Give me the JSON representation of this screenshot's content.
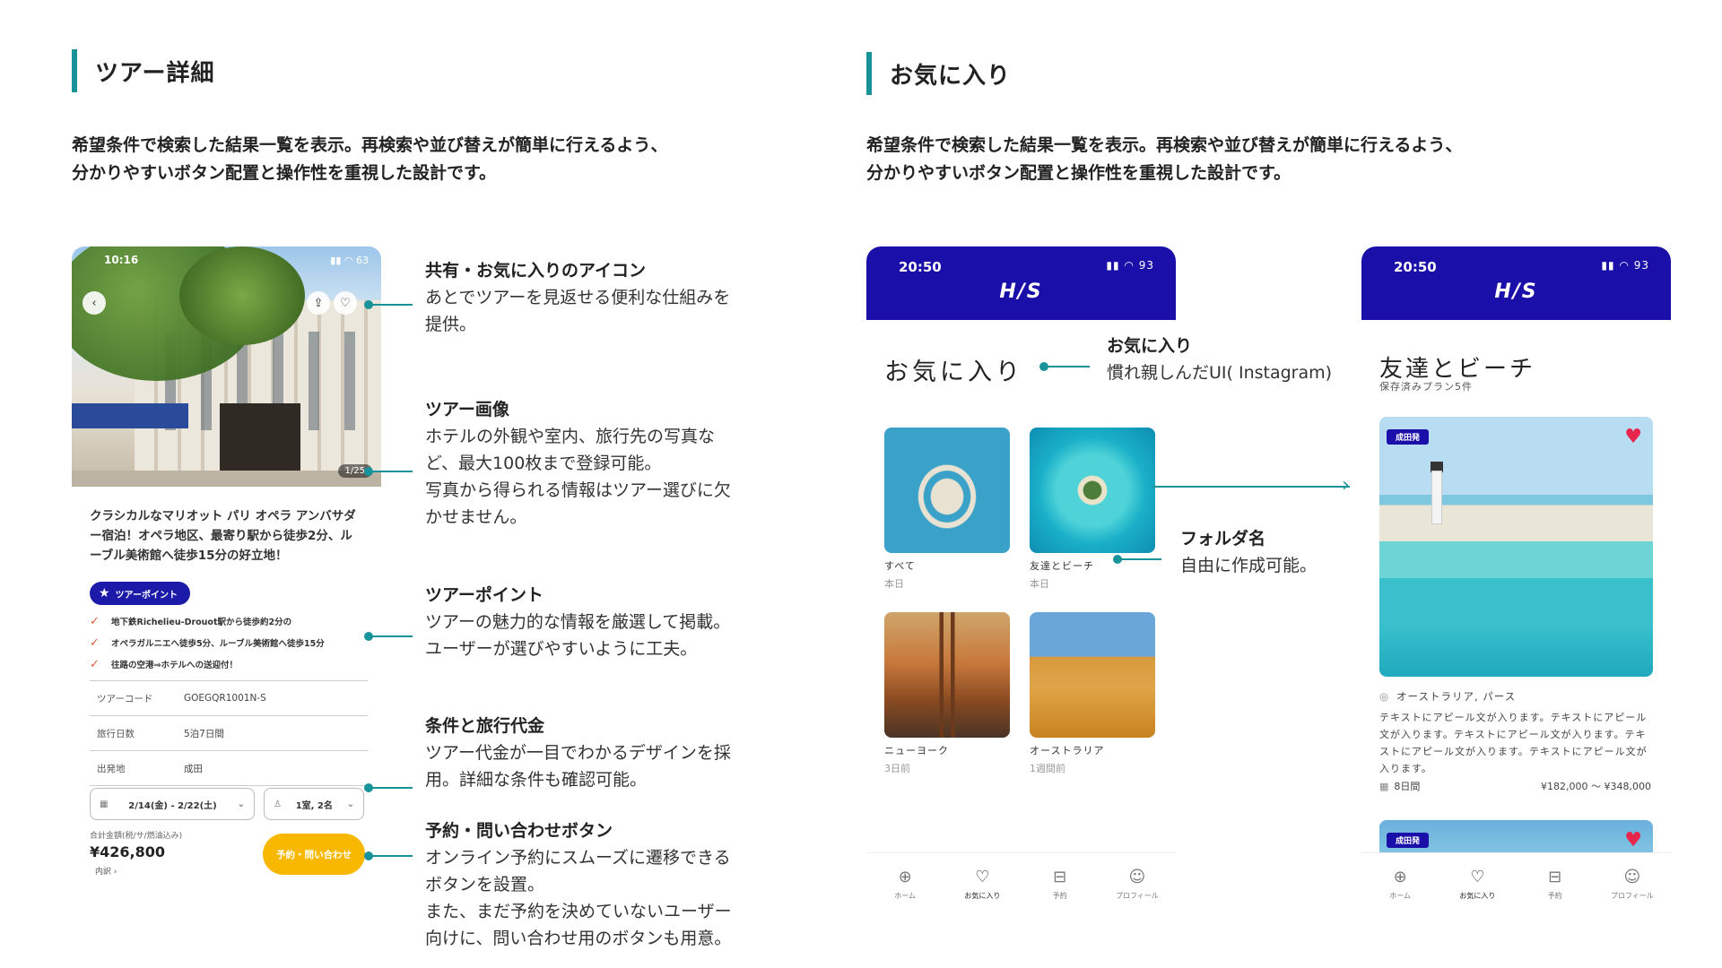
{
  "left": {
    "section_title": "ツアー詳細",
    "desc_line1": "希望条件で検索した結果一覧を表示。再検索や並び替えが簡単に行えるよう、",
    "desc_line2": "分かりやすいボタン配置と操作性を重視した設計です。",
    "phone": {
      "status_time": "10:16",
      "status_icons": "▮▮ ◠ 63",
      "back_icon": "chevron-left-icon",
      "photo_counter": "1/25",
      "title": "クラシカルなマリオット パリ オペラ アンバサダー宿泊！オペラ地区、最寄り駅から徒歩2分、ルーブル美術館へ徒歩15分の好立地！",
      "point_label": "ツアーポイント",
      "points": [
        "地下鉄Richelieu-Drouot駅から徒歩約2分の",
        "オペラガルニエへ徒歩5分、ルーブル美術館へ徒歩15分",
        "往路の空港⇒ホテルへの送迎付！"
      ],
      "info": [
        {
          "key": "ツアーコード",
          "value": "GOEGQR1001N-S"
        },
        {
          "key": "旅行日数",
          "value": "5泊7日間"
        },
        {
          "key": "出発地",
          "value": "成田"
        }
      ],
      "date_select": "2/14(金)  -  2/22(土)",
      "room_select": "1室, 2名",
      "total_label": "合計金額(税/サ/燃油込み)",
      "total_value": "¥426,800",
      "total_detail": "内訳 ›",
      "reserve_button": "予約・問い合わせ"
    },
    "callouts": [
      {
        "title": "共有・お気に入りのアイコン",
        "lines": [
          "あとでツアーを見返せる便利な仕組みを",
          "提供。"
        ]
      },
      {
        "title": "ツアー画像",
        "lines": [
          "ホテルの外観や室内、旅行先の写真な",
          "ど、最大100枚まで登録可能。",
          "写真から得られる情報はツアー選びに欠",
          "かせません。"
        ]
      },
      {
        "title": "ツアーポイント",
        "lines": [
          "ツアーの魅力的な情報を厳選して掲載。",
          "ユーザーが選びやすいように工夫。"
        ]
      },
      {
        "title": "条件と旅行代金",
        "lines": [
          "ツアー代金が一目でわかるデザインを採",
          "用。詳細な条件も確認可能。"
        ]
      },
      {
        "title": "予約・問い合わせボタン",
        "lines": [
          "オンライン予約にスムーズに遷移できる",
          "ボタンを設置。",
          "また、まだ予約を決めていないユーザー",
          "向けに、問い合わせ用のボタンも用意。"
        ]
      }
    ]
  },
  "right": {
    "section_title": "お気に入り",
    "desc_line1": "希望条件で検索した結果一覧を表示。再検索や並び替えが簡単に行えるよう、",
    "desc_line2": "分かりやすいボタン配置と操作性を重視した設計です。",
    "status_time": "20:50",
    "status_icons": "▮▮ ◠ 93",
    "logo": "H/S",
    "fav_title": "お気に入り",
    "folders": [
      {
        "name": "すべて",
        "time": "本日"
      },
      {
        "name": "友達とビーチ",
        "time": "本日"
      },
      {
        "name": "ニューヨーク",
        "time": "3日前"
      },
      {
        "name": "オーストラリア",
        "time": "1週間前"
      }
    ],
    "callout_fav": {
      "title": "お気に入り",
      "line": "慣れ親しんだUI( Instagram)"
    },
    "callout_folder": {
      "title": "フォルダ名",
      "line": "自由に作成可能。"
    },
    "folder_title": "友達とビーチ",
    "folder_sub": "保存済みプラン5件",
    "card": {
      "badge": "成田発",
      "location": "オーストラリア, パース",
      "text": "テキストにアピール文が入ります。テキストにアピール文が入ります。テキストにアピール文が入ります。テキストにアピール文が入ります。テキストにアピール文が入ります。",
      "days": "8日間",
      "price": "¥182,000 〜 ¥348,000"
    },
    "card2_badge": "成田発",
    "tabs": [
      {
        "icon": "globe-icon",
        "glyph": "⊕",
        "label": "ホーム"
      },
      {
        "icon": "heart-icon",
        "glyph": "♡",
        "label": "お気に入り"
      },
      {
        "icon": "suitcase-icon",
        "glyph": "⊟",
        "label": "予約"
      },
      {
        "icon": "profile-icon",
        "glyph": "☺",
        "label": "プロフィール"
      }
    ]
  },
  "colors": {
    "accent": "#18939a",
    "brand": "#1a0fa8",
    "reserve": "#f9b800",
    "heart": "#e8254a"
  }
}
